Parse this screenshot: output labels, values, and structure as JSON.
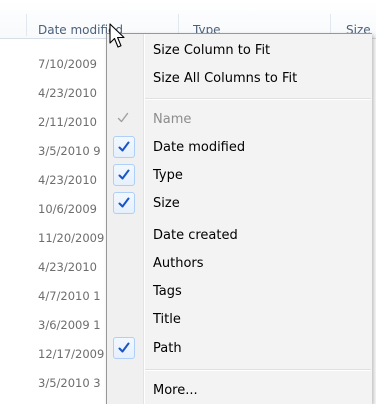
{
  "columns": [
    {
      "label": "Date modified"
    },
    {
      "label": "Type"
    },
    {
      "label": "Size"
    }
  ],
  "rows": [
    "7/10/2009",
    "4/23/2010",
    "2/11/2010",
    "3/5/2010 9",
    "4/23/2010",
    "10/6/2009",
    "11/20/2009",
    "4/23/2010",
    "4/7/2010 1",
    "3/6/2009 1",
    "12/17/2009",
    "3/5/2010 3"
  ],
  "menu": {
    "items": [
      {
        "label": "Size Column to Fit",
        "checked": false,
        "disabled": false
      },
      {
        "label": "Size All Columns to Fit",
        "checked": false,
        "disabled": false
      },
      {
        "label": "Name",
        "checked": true,
        "disabled": true
      },
      {
        "label": "Date modified",
        "checked": true,
        "disabled": false
      },
      {
        "label": "Type",
        "checked": true,
        "disabled": false
      },
      {
        "label": "Size",
        "checked": true,
        "disabled": false
      },
      {
        "label": "Date created",
        "checked": false,
        "disabled": false
      },
      {
        "label": "Authors",
        "checked": false,
        "disabled": false
      },
      {
        "label": "Tags",
        "checked": false,
        "disabled": false
      },
      {
        "label": "Title",
        "checked": false,
        "disabled": false
      },
      {
        "label": "Path",
        "checked": true,
        "disabled": false
      },
      {
        "label": "More...",
        "checked": false,
        "disabled": false
      }
    ]
  },
  "colors": {
    "check_enabled": "#1a55c8",
    "check_disabled": "#a0a0a0"
  }
}
